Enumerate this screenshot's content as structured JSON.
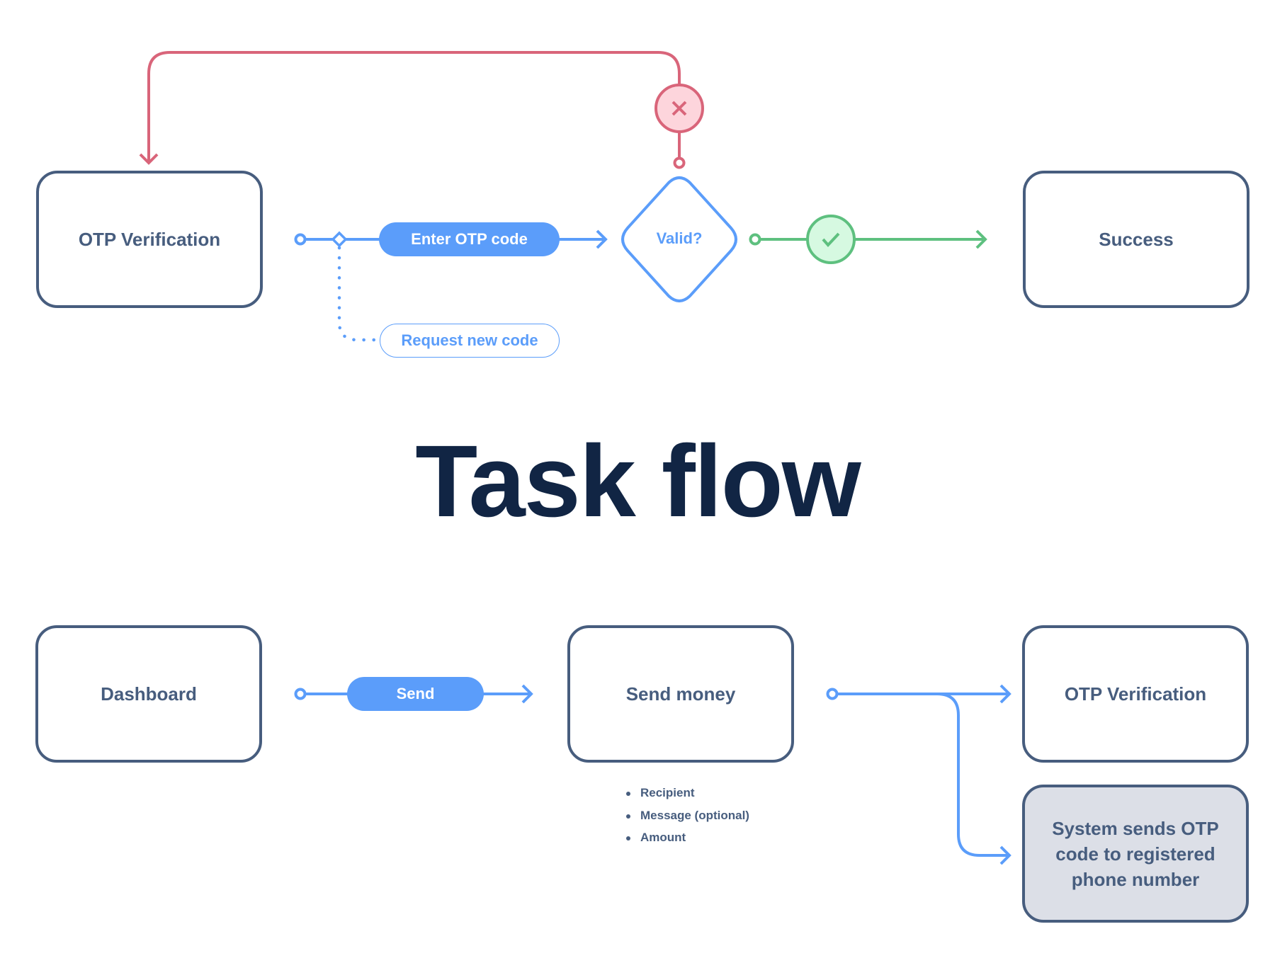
{
  "title": "Task flow",
  "colors": {
    "box_border": "#475d7e",
    "box_text": "#475d7e",
    "primary_blue": "#5b9dfa",
    "error_red": "#d9657a",
    "error_fill": "#fdd5dc",
    "success_green": "#5ec07f",
    "success_fill": "#d6f9e1",
    "grey_box_fill": "#dcdfe7",
    "title_color": "#112544"
  },
  "top_flow": {
    "start_screen": "OTP Verification",
    "action_primary": "Enter OTP code",
    "action_secondary": "Request new code",
    "decision": "Valid?",
    "invalid_icon": "close-icon",
    "valid_icon": "check-icon",
    "end_screen": "Success"
  },
  "bottom_flow": {
    "start_screen": "Dashboard",
    "action": "Send",
    "middle_screen": "Send money",
    "middle_fields": [
      "Recipient",
      "Message (optional)",
      "Amount"
    ],
    "end_screen": "OTP Verification",
    "system_step": "System sends OTP code to registered phone number"
  }
}
